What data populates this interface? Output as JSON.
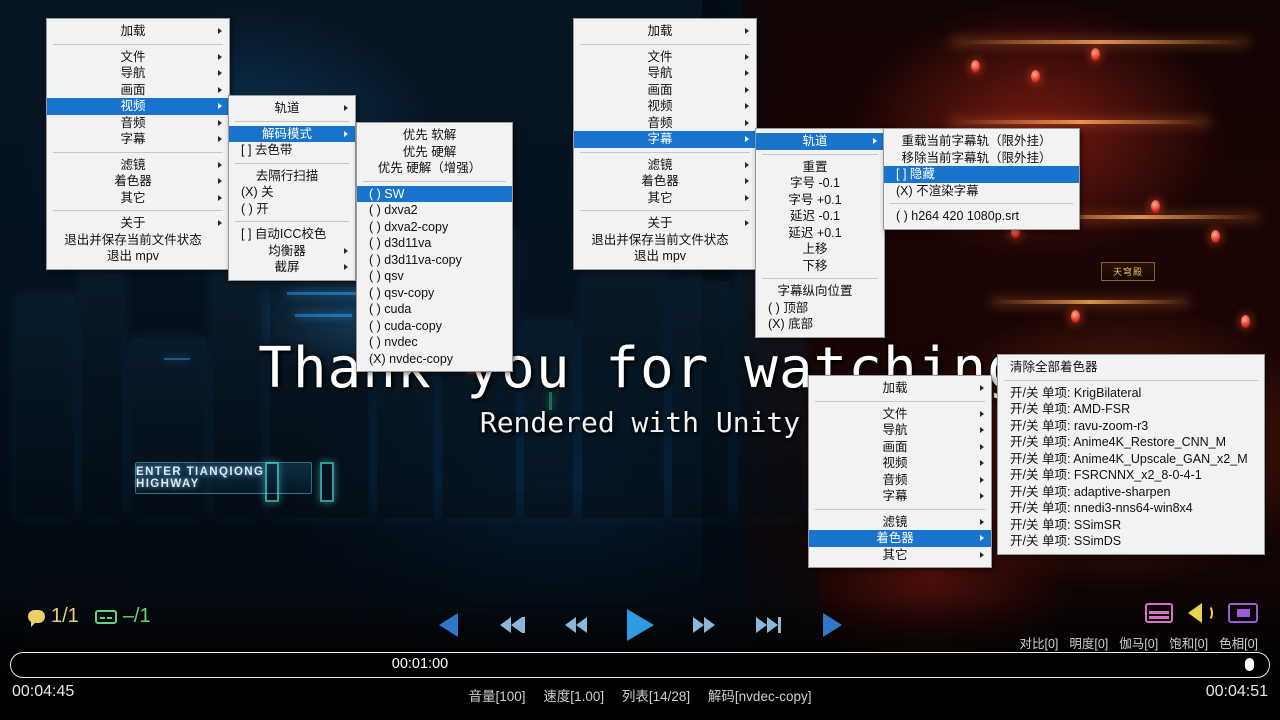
{
  "video": {
    "subtitle_main": "Thank you for watching",
    "subtitle_sub": "Rendered with Unity",
    "highway_sign": "ENTER TIANQIONG HIGHWAY",
    "temple_plaque": "天穹殿"
  },
  "menu_video": {
    "root": {
      "load": "加载",
      "items": [
        "文件",
        "导航",
        "画面",
        "视频",
        "音频",
        "字幕"
      ],
      "group2": [
        "滤镜",
        "着色器",
        "其它"
      ],
      "about": "关于",
      "quit_save": "退出并保存当前文件状态",
      "quit": "退出 mpv"
    },
    "col2": {
      "track": "轨道",
      "decode_mode": "解码模式",
      "deband": "[ ] 去色带",
      "deinterlace_title": "去隔行扫描",
      "deinterlace_off": "(X) 关",
      "deinterlace_on": "( ) 开",
      "icc": "[ ] 自动ICC校色",
      "equalizer": "均衡器",
      "screenshot": "截屏"
    },
    "col3": {
      "prefer": [
        "优先 软解",
        "优先 硬解",
        "优先 硬解（增强）"
      ],
      "hwdec": [
        "( ) SW",
        "( ) dxva2",
        "( ) dxva2-copy",
        "( ) d3d11va",
        "( ) d3d11va-copy",
        "( ) qsv",
        "( ) qsv-copy",
        "( ) cuda",
        "( ) cuda-copy",
        "( ) nvdec",
        "(X) nvdec-copy"
      ]
    }
  },
  "menu_sub": {
    "root": {
      "load": "加载",
      "items": [
        "文件",
        "导航",
        "画面",
        "视频",
        "音频",
        "字幕"
      ],
      "group2": [
        "滤镜",
        "着色器",
        "其它"
      ],
      "about": "关于",
      "quit_save": "退出并保存当前文件状态",
      "quit": "退出 mpv"
    },
    "col2": {
      "track": "轨道",
      "reset": "重置",
      "size_down": "字号 -0.1",
      "size_up": "字号 +0.1",
      "delay_down": "延迟 -0.1",
      "delay_up": "延迟 +0.1",
      "move_up": "上移",
      "move_down": "下移",
      "vertical_title": "字幕纵向位置",
      "pos_top": "( ) 顶部",
      "pos_bottom": "(X) 底部"
    },
    "col3": {
      "reload": "重载当前字幕轨（限外挂）",
      "remove": "移除当前字幕轨（限外挂）",
      "hide": "[ ] 隐藏",
      "no_render": "(X) 不渲染字幕",
      "track_file": "( ) h264 420 1080p.srt"
    }
  },
  "menu_shader": {
    "root": {
      "load": "加载",
      "items": [
        "文件",
        "导航",
        "画面",
        "视频",
        "音频",
        "字幕"
      ],
      "group2": [
        "滤镜",
        "着色器",
        "其它"
      ]
    },
    "col2": {
      "clear_all": "清除全部着色器",
      "prefix": "开/关 单项:",
      "shaders": [
        "KrigBilateral",
        "AMD-FSR",
        "ravu-zoom-r3",
        "Anime4K_Restore_CNN_M",
        "Anime4K_Upscale_GAN_x2_M",
        "FSRCNNX_x2_8-0-4-1",
        "adaptive-sharpen",
        "nnedi3-nns64-win8x4",
        "SSimSR",
        "SSimDS"
      ]
    }
  },
  "osc": {
    "audio_track": "1/1",
    "sub_track": "–/1",
    "seek_time": "00:01:00",
    "time_elapsed": "00:04:45",
    "time_total": "00:04:51",
    "status": [
      "音量[100]",
      "速度[1.00]",
      "列表[14/28]",
      "解码[nvdec-copy]"
    ],
    "color_stats": [
      "对比[0]",
      "明度[0]",
      "伽马[0]",
      "饱和[0]",
      "色相[0]"
    ],
    "colors": {
      "accent_blue": "#2f9ae0",
      "audio_yellow": "#ead06a",
      "sub_green": "#63d47e",
      "window_pink": "#d573c9",
      "screen_purple": "#9a5bd6",
      "menu_highlight": "#1874cd"
    }
  }
}
